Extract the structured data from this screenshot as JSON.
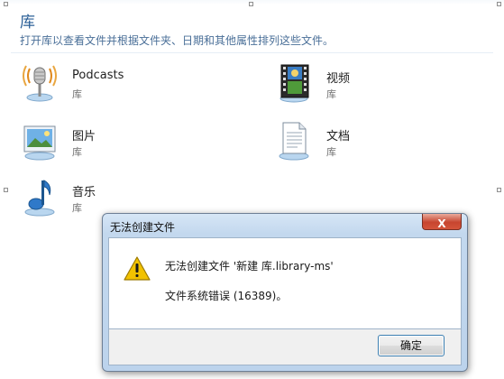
{
  "header": {
    "title": "库",
    "description": "打开库以查看文件并根据文件夹、日期和其他属性排列这些文件。"
  },
  "libraries": [
    {
      "name": "Podcasts",
      "type": "库",
      "icon": "microphone-icon"
    },
    {
      "name": "视频",
      "type": "库",
      "icon": "film-icon"
    },
    {
      "name": "图片",
      "type": "库",
      "icon": "picture-icon"
    },
    {
      "name": "文档",
      "type": "库",
      "icon": "document-icon"
    },
    {
      "name": "音乐",
      "type": "库",
      "icon": "music-note-icon"
    }
  ],
  "dialog": {
    "title": "无法创建文件",
    "close_label": "X",
    "message": "无法创建文件 '新建 库.library-ms'",
    "error": "文件系统错误 (16389)。",
    "ok_label": "确定",
    "icon": "warning-icon"
  },
  "colors": {
    "title_blue": "#2b5f97",
    "desc_blue": "#4a6f98",
    "close_red": "#c7452f",
    "warning_yellow": "#f2c200"
  }
}
